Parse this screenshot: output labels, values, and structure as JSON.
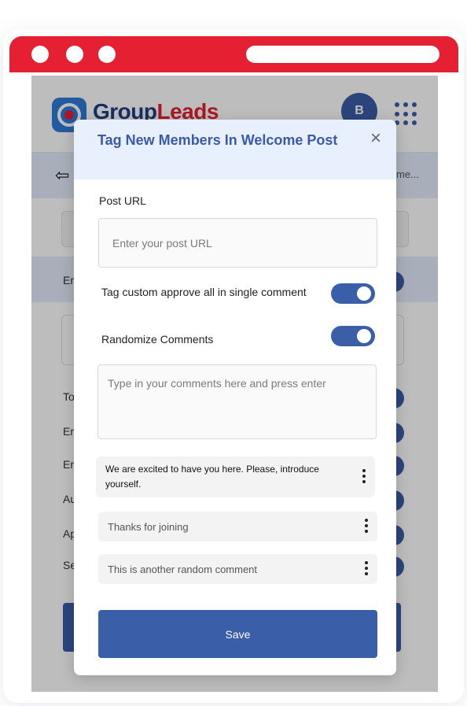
{
  "app": {
    "brand_prefix": "Group",
    "brand_suffix": "Leads",
    "avatar_initial": "B",
    "subbar_text": "me...",
    "background_row_labels": [
      "Er",
      "To",
      "Er",
      "Er",
      "Au",
      "Ap",
      "Se"
    ]
  },
  "modal": {
    "title": "Tag New Members In Welcome Post",
    "close_icon": "×",
    "post_url": {
      "label": "Post URL",
      "placeholder": "Enter your post URL",
      "value": ""
    },
    "options": [
      {
        "label": "Tag custom approve all in single comment",
        "enabled": true
      },
      {
        "label": "Randomize Comments",
        "enabled": true
      }
    ],
    "comments_input": {
      "placeholder": "Type in your comments here and press enter",
      "value": ""
    },
    "comments": [
      "We are excited to have you here. Please, introduce yourself.",
      "Thanks for joining",
      "This is another random comment"
    ],
    "save_label": "Save"
  },
  "colors": {
    "brand_red": "#e52033",
    "primary_blue": "#3b5ea8",
    "header_tint": "#e8effd"
  },
  "icons": {
    "back": "back-arrow-icon",
    "apps": "apps-grid-icon",
    "close": "close-icon",
    "kebab": "kebab-menu-icon"
  }
}
